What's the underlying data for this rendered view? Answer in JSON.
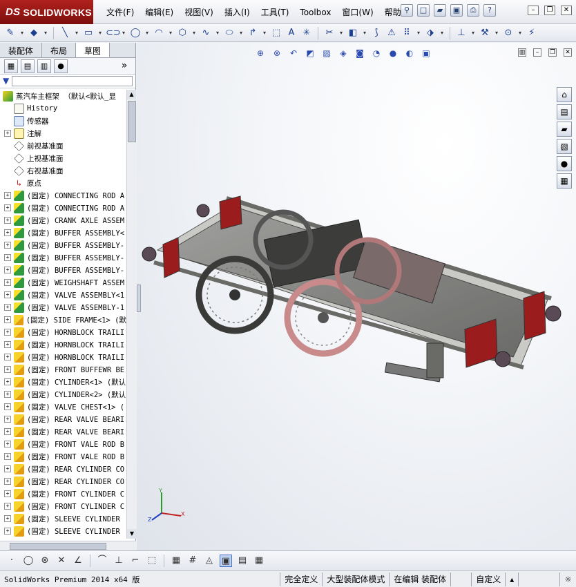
{
  "app": {
    "logo_text": "SOLIDWORKS",
    "logo_ds": "DS"
  },
  "menu": [
    "文件(F)",
    "编辑(E)",
    "视图(V)",
    "插入(I)",
    "工具(T)",
    "Toolbox",
    "窗口(W)",
    "帮助(H)"
  ],
  "tabs": [
    "装配体",
    "布局",
    "草图"
  ],
  "tree": {
    "root": "蒸汽车主框架 （默认<默认_显",
    "history": "History",
    "sensors": "传感器",
    "annotations": "注解",
    "front_plane": "前视基准面",
    "top_plane": "上视基准面",
    "right_plane": "右视基准面",
    "origin": "原点",
    "components": [
      {
        "label": "(固定) CONNECTING ROD A",
        "kind": "asm"
      },
      {
        "label": "(固定) CONNECTING ROD A",
        "kind": "asm"
      },
      {
        "label": "(固定) CRANK AXLE ASSEM",
        "kind": "asm"
      },
      {
        "label": "(固定) BUFFER ASSEMBLY<",
        "kind": "asm"
      },
      {
        "label": "(固定) BUFFER ASSEMBLY-",
        "kind": "asm"
      },
      {
        "label": "(固定) BUFFER ASSEMBLY-",
        "kind": "asm"
      },
      {
        "label": "(固定) BUFFER ASSEMBLY-",
        "kind": "asm"
      },
      {
        "label": "(固定) WEIGHSHAFT ASSEM",
        "kind": "asm"
      },
      {
        "label": "(固定) VALVE ASSEMBLY<1",
        "kind": "asm"
      },
      {
        "label": "(固定) VALVE ASSEMBLY-1",
        "kind": "asm"
      },
      {
        "label": "(固定) SIDE FRAME<1> (默",
        "kind": "part"
      },
      {
        "label": "(固定) HORNBLOCK TRAILI",
        "kind": "part"
      },
      {
        "label": "(固定) HORNBLOCK TRAILI",
        "kind": "part"
      },
      {
        "label": "(固定) HORNBLOCK TRAILI",
        "kind": "part"
      },
      {
        "label": "(固定) FRONT BUFFEWR BE",
        "kind": "part"
      },
      {
        "label": "(固定) CYLINDER<1> (默认",
        "kind": "part"
      },
      {
        "label": "(固定) CYLINDER<2> (默认",
        "kind": "part"
      },
      {
        "label": "(固定) VALVE CHEST<1> (",
        "kind": "part"
      },
      {
        "label": "(固定) REAR VALVE BEARI",
        "kind": "part"
      },
      {
        "label": "(固定) REAR VALVE BEARI",
        "kind": "part"
      },
      {
        "label": "(固定) FRONT VALE ROD B",
        "kind": "part"
      },
      {
        "label": "(固定) FRONT VALE ROD B",
        "kind": "part"
      },
      {
        "label": "(固定) REAR CYLINDER CO",
        "kind": "part"
      },
      {
        "label": "(固定) REAR CYLINDER CO",
        "kind": "part"
      },
      {
        "label": "(固定) FRONT CYLINDER C",
        "kind": "part"
      },
      {
        "label": "(固定) FRONT CYLINDER C",
        "kind": "part"
      },
      {
        "label": "(固定) SLEEVE CYLINDER",
        "kind": "part"
      },
      {
        "label": "(固定) SLEEVE CYLINDER",
        "kind": "part"
      }
    ]
  },
  "status": {
    "version": "SolidWorks Premium 2014 x64 版",
    "definition": "完全定义",
    "mode": "大型装配体模式",
    "editing": "在编辑 装配体",
    "units": "自定义"
  },
  "triad": {
    "x": "X",
    "y": "Y",
    "z": "Z"
  }
}
